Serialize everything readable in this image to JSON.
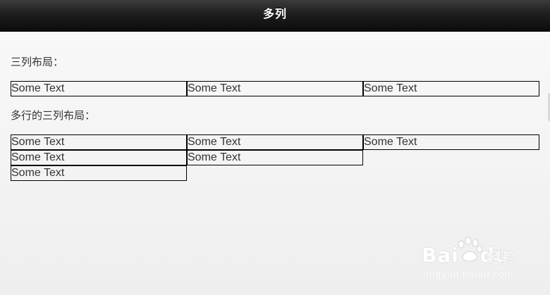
{
  "header": {
    "title": "多列"
  },
  "sections": [
    {
      "heading": "三列布局：",
      "rows": [
        [
          "Some Text",
          "Some Text",
          "Some Text"
        ]
      ]
    },
    {
      "heading": "多行的三列布局：",
      "rows": [
        [
          "Some Text",
          "Some Text",
          "Some Text"
        ],
        [
          "Some Text",
          "Some Text"
        ],
        [
          "Some Text"
        ]
      ]
    }
  ],
  "watermark": {
    "logo": "Bai",
    "logo_suffix": "du",
    "product": "经验",
    "url": "jingyan.baidu.com"
  },
  "colors": {
    "header_bg": "#1e1e1e",
    "header_text": "#ffffff",
    "page_bg": "#f5f5f5",
    "cell_border": "#000000",
    "text": "#333333"
  }
}
